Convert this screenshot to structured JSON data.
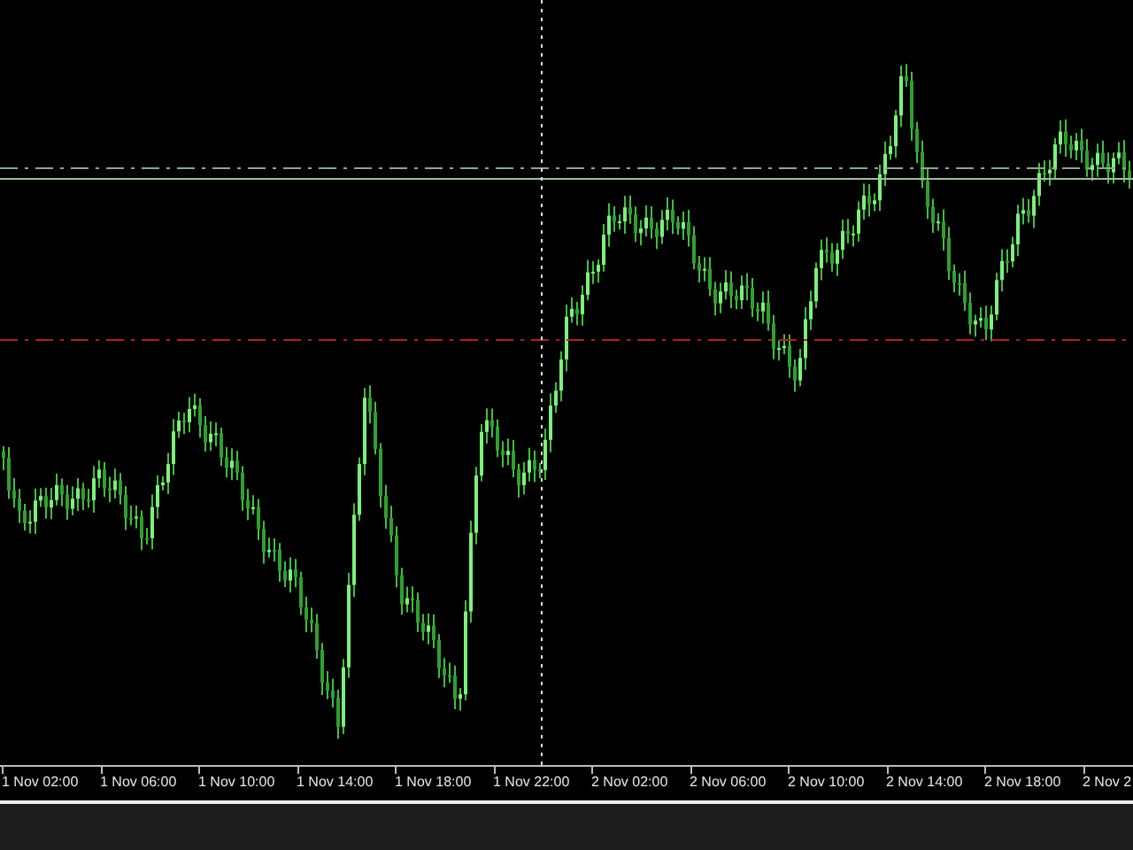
{
  "chart": {
    "time_axis": {
      "labels": [
        "1 Nov 02:00",
        "1 Nov 06:00",
        "1 Nov 10:00",
        "1 Nov 14:00",
        "1 Nov 18:00",
        "1 Nov 22:00",
        "2 Nov 02:00",
        "2 Nov 06:00",
        "2 Nov 10:00",
        "2 Nov 14:00",
        "2 Nov 18:00",
        "2 Nov 2"
      ]
    }
  }
}
